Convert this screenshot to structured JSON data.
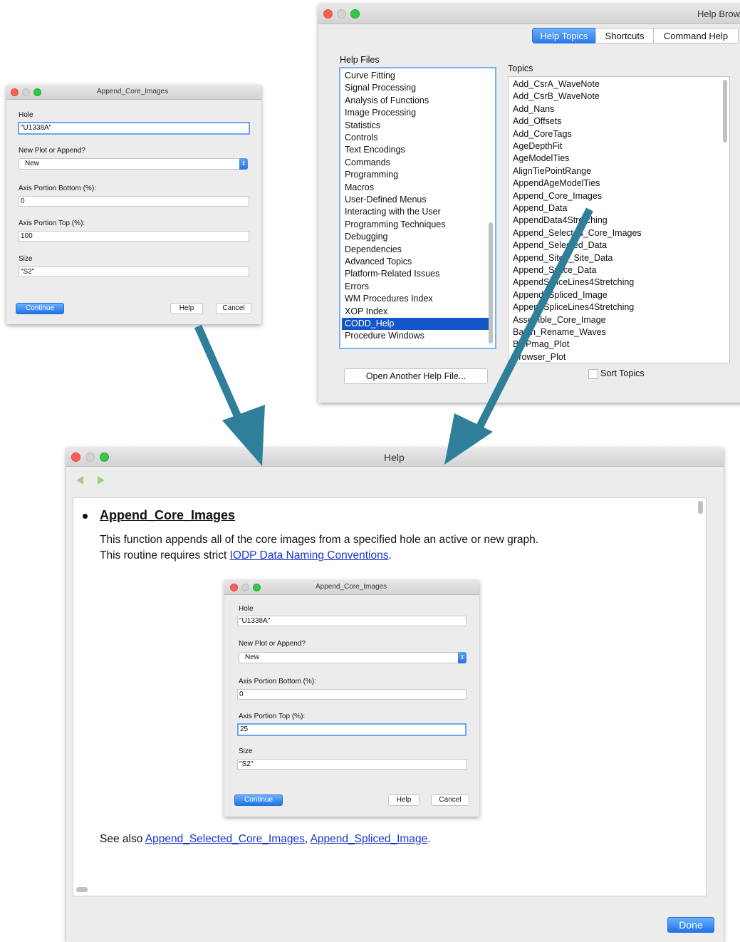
{
  "dialog_top": {
    "title": "Append_Core_Images",
    "fields": [
      {
        "label": "Hole",
        "value": "\"U1338A\""
      },
      {
        "label": "New Plot or Append?",
        "value": "New"
      },
      {
        "label": "Axis Portion Bottom (%):",
        "value": "0"
      },
      {
        "label": "Axis Portion Top (%):",
        "value": "100"
      },
      {
        "label": "Size",
        "value": "\"S2\""
      }
    ],
    "buttons": {
      "continue": "Continue",
      "help": "Help",
      "cancel": "Cancel"
    }
  },
  "help_browser": {
    "title": "Help Brow",
    "tabs": [
      "Help Topics",
      "Shortcuts",
      "Command Help"
    ],
    "help_files_label": "Help Files",
    "help_files": [
      "Curve Fitting",
      "Signal Processing",
      "Analysis of Functions",
      "Image Processing",
      "Statistics",
      "Controls",
      "Text Encodings",
      "Commands",
      "Programming",
      "Macros",
      "User-Defined Menus",
      "Interacting with the User",
      "Programming Techniques",
      "Debugging",
      "Dependencies",
      "Advanced Topics",
      "Platform-Related Issues",
      "Errors",
      "WM Procedures Index",
      "XOP Index",
      "CODD_Help",
      "Procedure Windows"
    ],
    "selected_help_file": "CODD_Help",
    "topics_label": "Topics",
    "topics": [
      "Add_CsrA_WaveNote",
      "Add_CsrB_WaveNote",
      "Add_Nans",
      "Add_Offsets",
      "Add_CoreTags",
      "AgeDepthFit",
      "AgeModelTies",
      "AlignTiePointRange",
      "AppendAgeModelTies",
      "Append_Core_Images",
      "Append_Data",
      "AppendData4Stretching",
      "Append_Selected_Core_Images",
      "Append_Selected_Data",
      "Append_Site2_Site_Data",
      "Append_Splice_Data",
      "AppendSpliceLines4Stretching",
      "Append_Spliced_Image",
      "AppendSpliceLines4Stretching",
      "Assemble_Core_Image",
      "Batch_Rename_Waves",
      "BioPmag_Plot",
      "Browser_Plot"
    ],
    "open_button": "Open Another Help File...",
    "sort_topics": "Sort Topics"
  },
  "help_window": {
    "title": "Help",
    "heading": "Append_Core_Images",
    "line1": "This function appends all of the core images from a specified hole an active or new graph.",
    "line2_prefix": "This routine requires strict ",
    "line2_link": "IODP Data Naming Conventions",
    "line2_suffix": ".",
    "see_also_prefix": "See also ",
    "see_also_link1": "Append_Selected_Core_Images",
    "see_also_sep": ", ",
    "see_also_link2": "Append_Spliced_Image",
    "see_also_suffix": ".",
    "done": "Done",
    "embedded_dialog": {
      "title": "Append_Core_Images",
      "fields": [
        {
          "label": "Hole",
          "value": "\"U1338A\""
        },
        {
          "label": "New Plot or Append?",
          "value": "New"
        },
        {
          "label": "Axis Portion Bottom (%):",
          "value": "0"
        },
        {
          "label": "Axis Portion Top (%):",
          "value": "25"
        },
        {
          "label": "Size",
          "value": "\"S2\""
        }
      ],
      "buttons": {
        "continue": "Continue",
        "help": "Help",
        "cancel": "Cancel"
      }
    }
  },
  "colors": {
    "arrow": "#2f7f9a",
    "selection": "#1456c7",
    "accent": "#2a7bea",
    "link": "#1a33d1"
  }
}
